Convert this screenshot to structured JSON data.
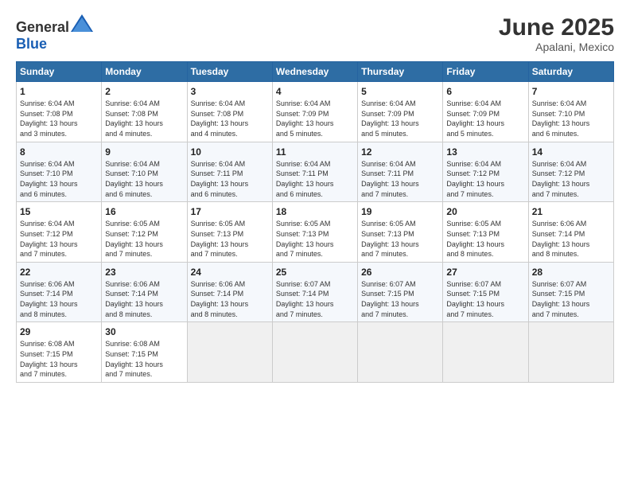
{
  "header": {
    "logo_general": "General",
    "logo_blue": "Blue",
    "month": "June 2025",
    "location": "Apalani, Mexico"
  },
  "days_of_week": [
    "Sunday",
    "Monday",
    "Tuesday",
    "Wednesday",
    "Thursday",
    "Friday",
    "Saturday"
  ],
  "weeks": [
    [
      {
        "day": "1",
        "info": "Sunrise: 6:04 AM\nSunset: 7:08 PM\nDaylight: 13 hours\nand 3 minutes."
      },
      {
        "day": "2",
        "info": "Sunrise: 6:04 AM\nSunset: 7:08 PM\nDaylight: 13 hours\nand 4 minutes."
      },
      {
        "day": "3",
        "info": "Sunrise: 6:04 AM\nSunset: 7:08 PM\nDaylight: 13 hours\nand 4 minutes."
      },
      {
        "day": "4",
        "info": "Sunrise: 6:04 AM\nSunset: 7:09 PM\nDaylight: 13 hours\nand 5 minutes."
      },
      {
        "day": "5",
        "info": "Sunrise: 6:04 AM\nSunset: 7:09 PM\nDaylight: 13 hours\nand 5 minutes."
      },
      {
        "day": "6",
        "info": "Sunrise: 6:04 AM\nSunset: 7:09 PM\nDaylight: 13 hours\nand 5 minutes."
      },
      {
        "day": "7",
        "info": "Sunrise: 6:04 AM\nSunset: 7:10 PM\nDaylight: 13 hours\nand 6 minutes."
      }
    ],
    [
      {
        "day": "8",
        "info": "Sunrise: 6:04 AM\nSunset: 7:10 PM\nDaylight: 13 hours\nand 6 minutes."
      },
      {
        "day": "9",
        "info": "Sunrise: 6:04 AM\nSunset: 7:10 PM\nDaylight: 13 hours\nand 6 minutes."
      },
      {
        "day": "10",
        "info": "Sunrise: 6:04 AM\nSunset: 7:11 PM\nDaylight: 13 hours\nand 6 minutes."
      },
      {
        "day": "11",
        "info": "Sunrise: 6:04 AM\nSunset: 7:11 PM\nDaylight: 13 hours\nand 6 minutes."
      },
      {
        "day": "12",
        "info": "Sunrise: 6:04 AM\nSunset: 7:11 PM\nDaylight: 13 hours\nand 7 minutes."
      },
      {
        "day": "13",
        "info": "Sunrise: 6:04 AM\nSunset: 7:12 PM\nDaylight: 13 hours\nand 7 minutes."
      },
      {
        "day": "14",
        "info": "Sunrise: 6:04 AM\nSunset: 7:12 PM\nDaylight: 13 hours\nand 7 minutes."
      }
    ],
    [
      {
        "day": "15",
        "info": "Sunrise: 6:04 AM\nSunset: 7:12 PM\nDaylight: 13 hours\nand 7 minutes."
      },
      {
        "day": "16",
        "info": "Sunrise: 6:05 AM\nSunset: 7:12 PM\nDaylight: 13 hours\nand 7 minutes."
      },
      {
        "day": "17",
        "info": "Sunrise: 6:05 AM\nSunset: 7:13 PM\nDaylight: 13 hours\nand 7 minutes."
      },
      {
        "day": "18",
        "info": "Sunrise: 6:05 AM\nSunset: 7:13 PM\nDaylight: 13 hours\nand 7 minutes."
      },
      {
        "day": "19",
        "info": "Sunrise: 6:05 AM\nSunset: 7:13 PM\nDaylight: 13 hours\nand 7 minutes."
      },
      {
        "day": "20",
        "info": "Sunrise: 6:05 AM\nSunset: 7:13 PM\nDaylight: 13 hours\nand 8 minutes."
      },
      {
        "day": "21",
        "info": "Sunrise: 6:06 AM\nSunset: 7:14 PM\nDaylight: 13 hours\nand 8 minutes."
      }
    ],
    [
      {
        "day": "22",
        "info": "Sunrise: 6:06 AM\nSunset: 7:14 PM\nDaylight: 13 hours\nand 8 minutes."
      },
      {
        "day": "23",
        "info": "Sunrise: 6:06 AM\nSunset: 7:14 PM\nDaylight: 13 hours\nand 8 minutes."
      },
      {
        "day": "24",
        "info": "Sunrise: 6:06 AM\nSunset: 7:14 PM\nDaylight: 13 hours\nand 8 minutes."
      },
      {
        "day": "25",
        "info": "Sunrise: 6:07 AM\nSunset: 7:14 PM\nDaylight: 13 hours\nand 7 minutes."
      },
      {
        "day": "26",
        "info": "Sunrise: 6:07 AM\nSunset: 7:15 PM\nDaylight: 13 hours\nand 7 minutes."
      },
      {
        "day": "27",
        "info": "Sunrise: 6:07 AM\nSunset: 7:15 PM\nDaylight: 13 hours\nand 7 minutes."
      },
      {
        "day": "28",
        "info": "Sunrise: 6:07 AM\nSunset: 7:15 PM\nDaylight: 13 hours\nand 7 minutes."
      }
    ],
    [
      {
        "day": "29",
        "info": "Sunrise: 6:08 AM\nSunset: 7:15 PM\nDaylight: 13 hours\nand 7 minutes."
      },
      {
        "day": "30",
        "info": "Sunrise: 6:08 AM\nSunset: 7:15 PM\nDaylight: 13 hours\nand 7 minutes."
      },
      {
        "day": "",
        "info": ""
      },
      {
        "day": "",
        "info": ""
      },
      {
        "day": "",
        "info": ""
      },
      {
        "day": "",
        "info": ""
      },
      {
        "day": "",
        "info": ""
      }
    ]
  ]
}
